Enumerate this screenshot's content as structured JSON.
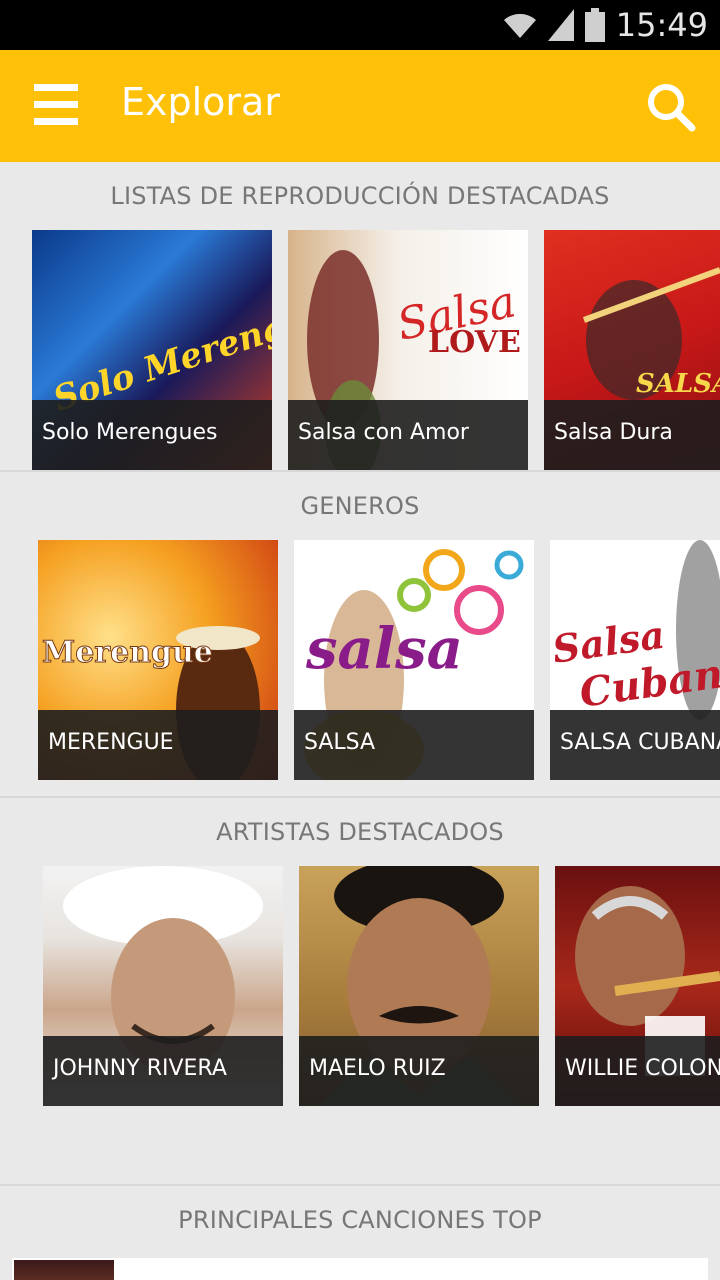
{
  "status_bar": {
    "time": "15:49",
    "icons": [
      "wifi-icon",
      "signal-icon",
      "battery-icon"
    ]
  },
  "app_bar": {
    "title": "Explorar",
    "menu_icon": "hamburger-menu-icon",
    "search_icon": "search-icon",
    "color": "#ffc107"
  },
  "sections": {
    "playlists": {
      "title": "LISTAS DE REPRODUCCIÓN DESTACADAS",
      "items": [
        {
          "label": "Solo Merengues",
          "art_text": "Solo Merengue"
        },
        {
          "label": "Salsa con Amor",
          "art_text": "Salsa LOVE"
        },
        {
          "label": "Salsa Dura",
          "art_text": "SALSA"
        }
      ]
    },
    "genres": {
      "title": "GENEROS",
      "items": [
        {
          "label": "MERENGUE",
          "art_text": "Merengue"
        },
        {
          "label": "SALSA",
          "art_text": "salsa"
        },
        {
          "label": "SALSA CUBANA",
          "art_text": "Salsa Cubana"
        }
      ]
    },
    "artists": {
      "title": "ARTISTAS DESTACADOS",
      "items": [
        {
          "label": "JOHNNY RIVERA"
        },
        {
          "label": "MAELO RUIZ"
        },
        {
          "label": "WILLIE COLON"
        }
      ]
    },
    "top_songs": {
      "title": "PRINCIPALES CANCIONES TOP"
    }
  }
}
